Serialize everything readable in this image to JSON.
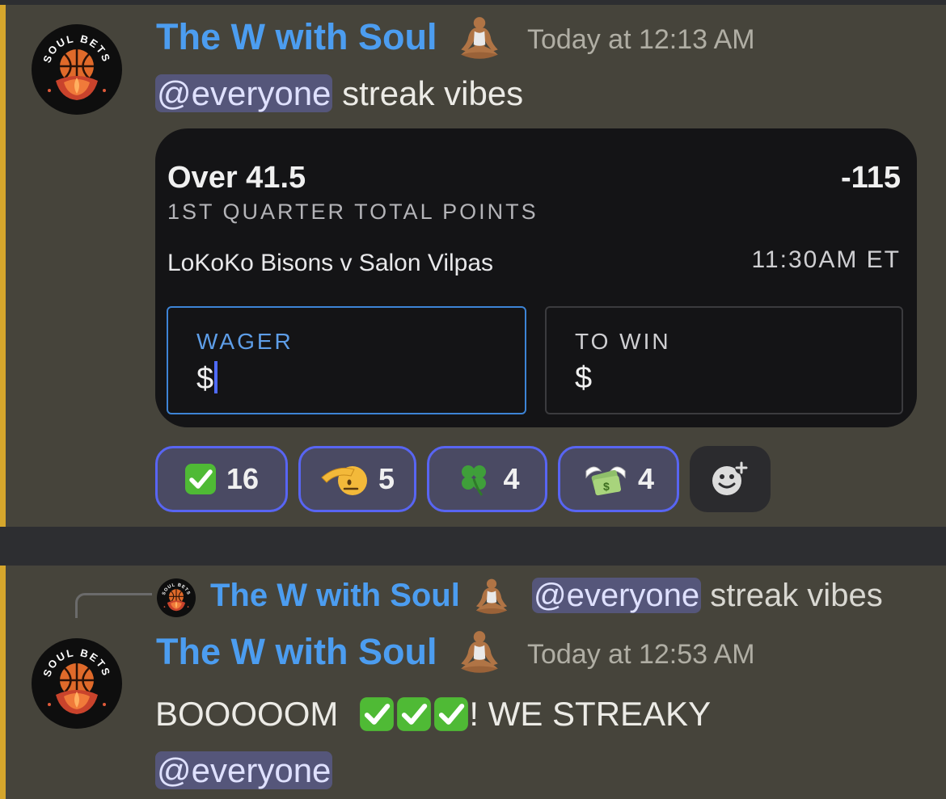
{
  "message1": {
    "author": "The W with Soul",
    "timestamp": "Today at 12:13 AM",
    "mention": "@everyone",
    "text": " streak vibes",
    "avatar_text": "SOUL BETS",
    "card": {
      "selection": "Over 41.5",
      "odds": "-115",
      "market": "1ST QUARTER TOTAL POINTS",
      "matchup": "LoKoKo Bisons v Salon Vilpas",
      "time": "11:30AM ET",
      "wager_label": "WAGER",
      "wager_value": "$",
      "to_win_label": "TO WIN",
      "to_win_value": "$"
    },
    "reactions": [
      {
        "icon": "check-mark-icon",
        "count": "16"
      },
      {
        "icon": "saluting-face-icon",
        "count": "5"
      },
      {
        "icon": "four-leaf-clover-icon",
        "count": "4"
      },
      {
        "icon": "money-with-wings-icon",
        "count": "4"
      }
    ]
  },
  "reply": {
    "author": "The W with Soul",
    "mention": "@everyone",
    "text": " streak vibes"
  },
  "message2": {
    "author": "The W with Soul",
    "timestamp": "Today at 12:53 AM",
    "text_before": "BOOOOOM",
    "text_after": "! WE STREAKY",
    "mention": "@everyone"
  },
  "colors": {
    "accent_name": "#4c9df0",
    "message_bg": "#46443b",
    "highlight_bar": "#d5a62c",
    "reaction_border": "#5865f2"
  }
}
